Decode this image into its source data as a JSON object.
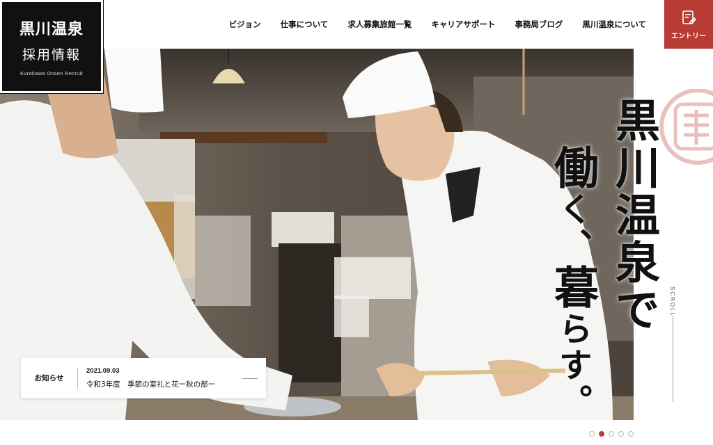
{
  "logo": {
    "title": "黒川温泉",
    "subtitle": "採用情報",
    "english": "Kurokawa Onsen Recruit"
  },
  "nav": {
    "items": [
      {
        "label": "ビジョン"
      },
      {
        "label": "仕事について"
      },
      {
        "label": "求人募集旅館一覧"
      },
      {
        "label": "キャリアサポート"
      },
      {
        "label": "事務局ブログ"
      },
      {
        "label": "黒川温泉について"
      }
    ]
  },
  "entry": {
    "label": "エントリー",
    "icon": "entry-form-icon",
    "color": "#b83b36"
  },
  "hero": {
    "catch_line1": "黒川温泉で",
    "catch_line2_a": "働",
    "catch_line2_b": "く、",
    "catch_line2_c": "暮",
    "catch_line2_d": "らす。",
    "scroll_label": "SCROLL"
  },
  "news": {
    "label": "お知らせ",
    "date": "2021.09.03",
    "title": "令和3年度　季節の室礼と花ー秋の部ー"
  },
  "slider": {
    "total": 5,
    "active_index": 1,
    "accent": "#b83b36"
  }
}
